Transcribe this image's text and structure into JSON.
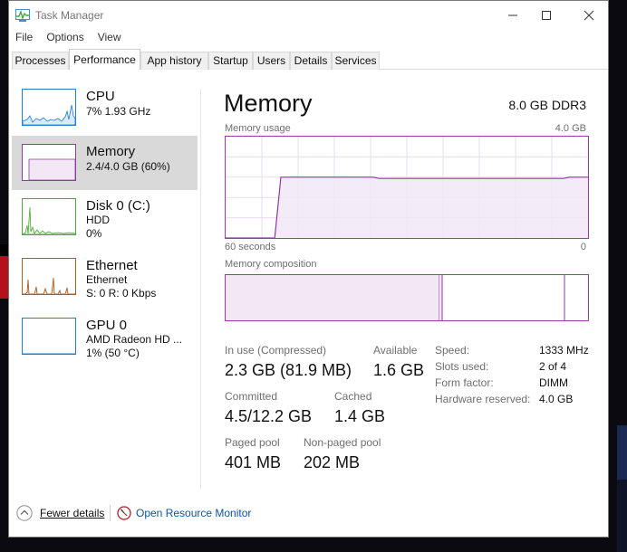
{
  "window": {
    "title": "Task Manager"
  },
  "menu": [
    "File",
    "Options",
    "View"
  ],
  "tabs": [
    "Processes",
    "Performance",
    "App history",
    "Startup",
    "Users",
    "Details",
    "Services"
  ],
  "active_tab": "Performance",
  "sidebar": [
    {
      "title": "CPU",
      "line1": "7%  1.93 GHz",
      "line2": "",
      "color": "#1c7ed6",
      "icon": "cpu-graph-icon"
    },
    {
      "title": "Memory",
      "line1": "2.4/4.0 GB (60%)",
      "line2": "",
      "color": "#8e3aa6",
      "icon": "memory-graph-icon"
    },
    {
      "title": "Disk 0 (C:)",
      "line1": "HDD",
      "line2": "0%",
      "color": "#4fa53a",
      "icon": "disk-graph-icon"
    },
    {
      "title": "Ethernet",
      "line1": "Ethernet",
      "line2": "S: 0  R: 0 Kbps",
      "color": "#b45d1a",
      "icon": "ethernet-graph-icon"
    },
    {
      "title": "GPU 0",
      "line1": "AMD Radeon HD ...",
      "line2": "1%  (50 °C)",
      "color": "#1c7ed6",
      "icon": "gpu-graph-icon"
    }
  ],
  "main": {
    "title": "Memory",
    "subtitle": "8.0 GB DDR3",
    "usage_label": "Memory usage",
    "usage_max": "4.0 GB",
    "time_left": "60 seconds",
    "time_right": "0",
    "composition_label": "Memory composition"
  },
  "stats": {
    "in_use_label": "In use (Compressed)",
    "in_use_value": "2.3 GB (81.9 MB)",
    "available_label": "Available",
    "available_value": "1.6 GB",
    "committed_label": "Committed",
    "committed_value": "4.5/12.2 GB",
    "cached_label": "Cached",
    "cached_value": "1.4 GB",
    "paged_label": "Paged pool",
    "paged_value": "401 MB",
    "nonpaged_label": "Non-paged pool",
    "nonpaged_value": "202 MB"
  },
  "details": [
    {
      "label": "Speed:",
      "value": "1333 MHz"
    },
    {
      "label": "Slots used:",
      "value": "2 of 4"
    },
    {
      "label": "Form factor:",
      "value": "DIMM"
    },
    {
      "label": "Hardware reserved:",
      "value": "4.0 GB"
    }
  ],
  "footer": {
    "fewer_details": "Fewer details",
    "resource_monitor": "Open Resource Monitor"
  },
  "colors": {
    "memory": "#8e3aa6",
    "memory_fill": "#f1e8f3",
    "link": "#0b56a8"
  },
  "chart_data": {
    "type": "area",
    "title": "Memory usage",
    "xlabel": "",
    "ylabel": "",
    "x_range_label": [
      "60 seconds",
      "0"
    ],
    "ylim": [
      0,
      4.0
    ],
    "y_unit": "GB",
    "series": [
      {
        "values": [
          0,
          0,
          0,
          0,
          0,
          0,
          0,
          0,
          0,
          2.4,
          2.4,
          2.4,
          2.4,
          2.4,
          2.4,
          2.4,
          2.4,
          2.4,
          2.4,
          2.4,
          2.4,
          2.4,
          2.4,
          2.4,
          2.4,
          2.35,
          2.35,
          2.35,
          2.35,
          2.35,
          2.35,
          2.35,
          2.35,
          2.35,
          2.35,
          2.35,
          2.35,
          2.35,
          2.35,
          2.35,
          2.35,
          2.35,
          2.35,
          2.35,
          2.35,
          2.35,
          2.35,
          2.35,
          2.35,
          2.35,
          2.35,
          2.35,
          2.35,
          2.35,
          2.35,
          2.35,
          2.4,
          2.4,
          2.4,
          2.4
        ]
      }
    ]
  }
}
